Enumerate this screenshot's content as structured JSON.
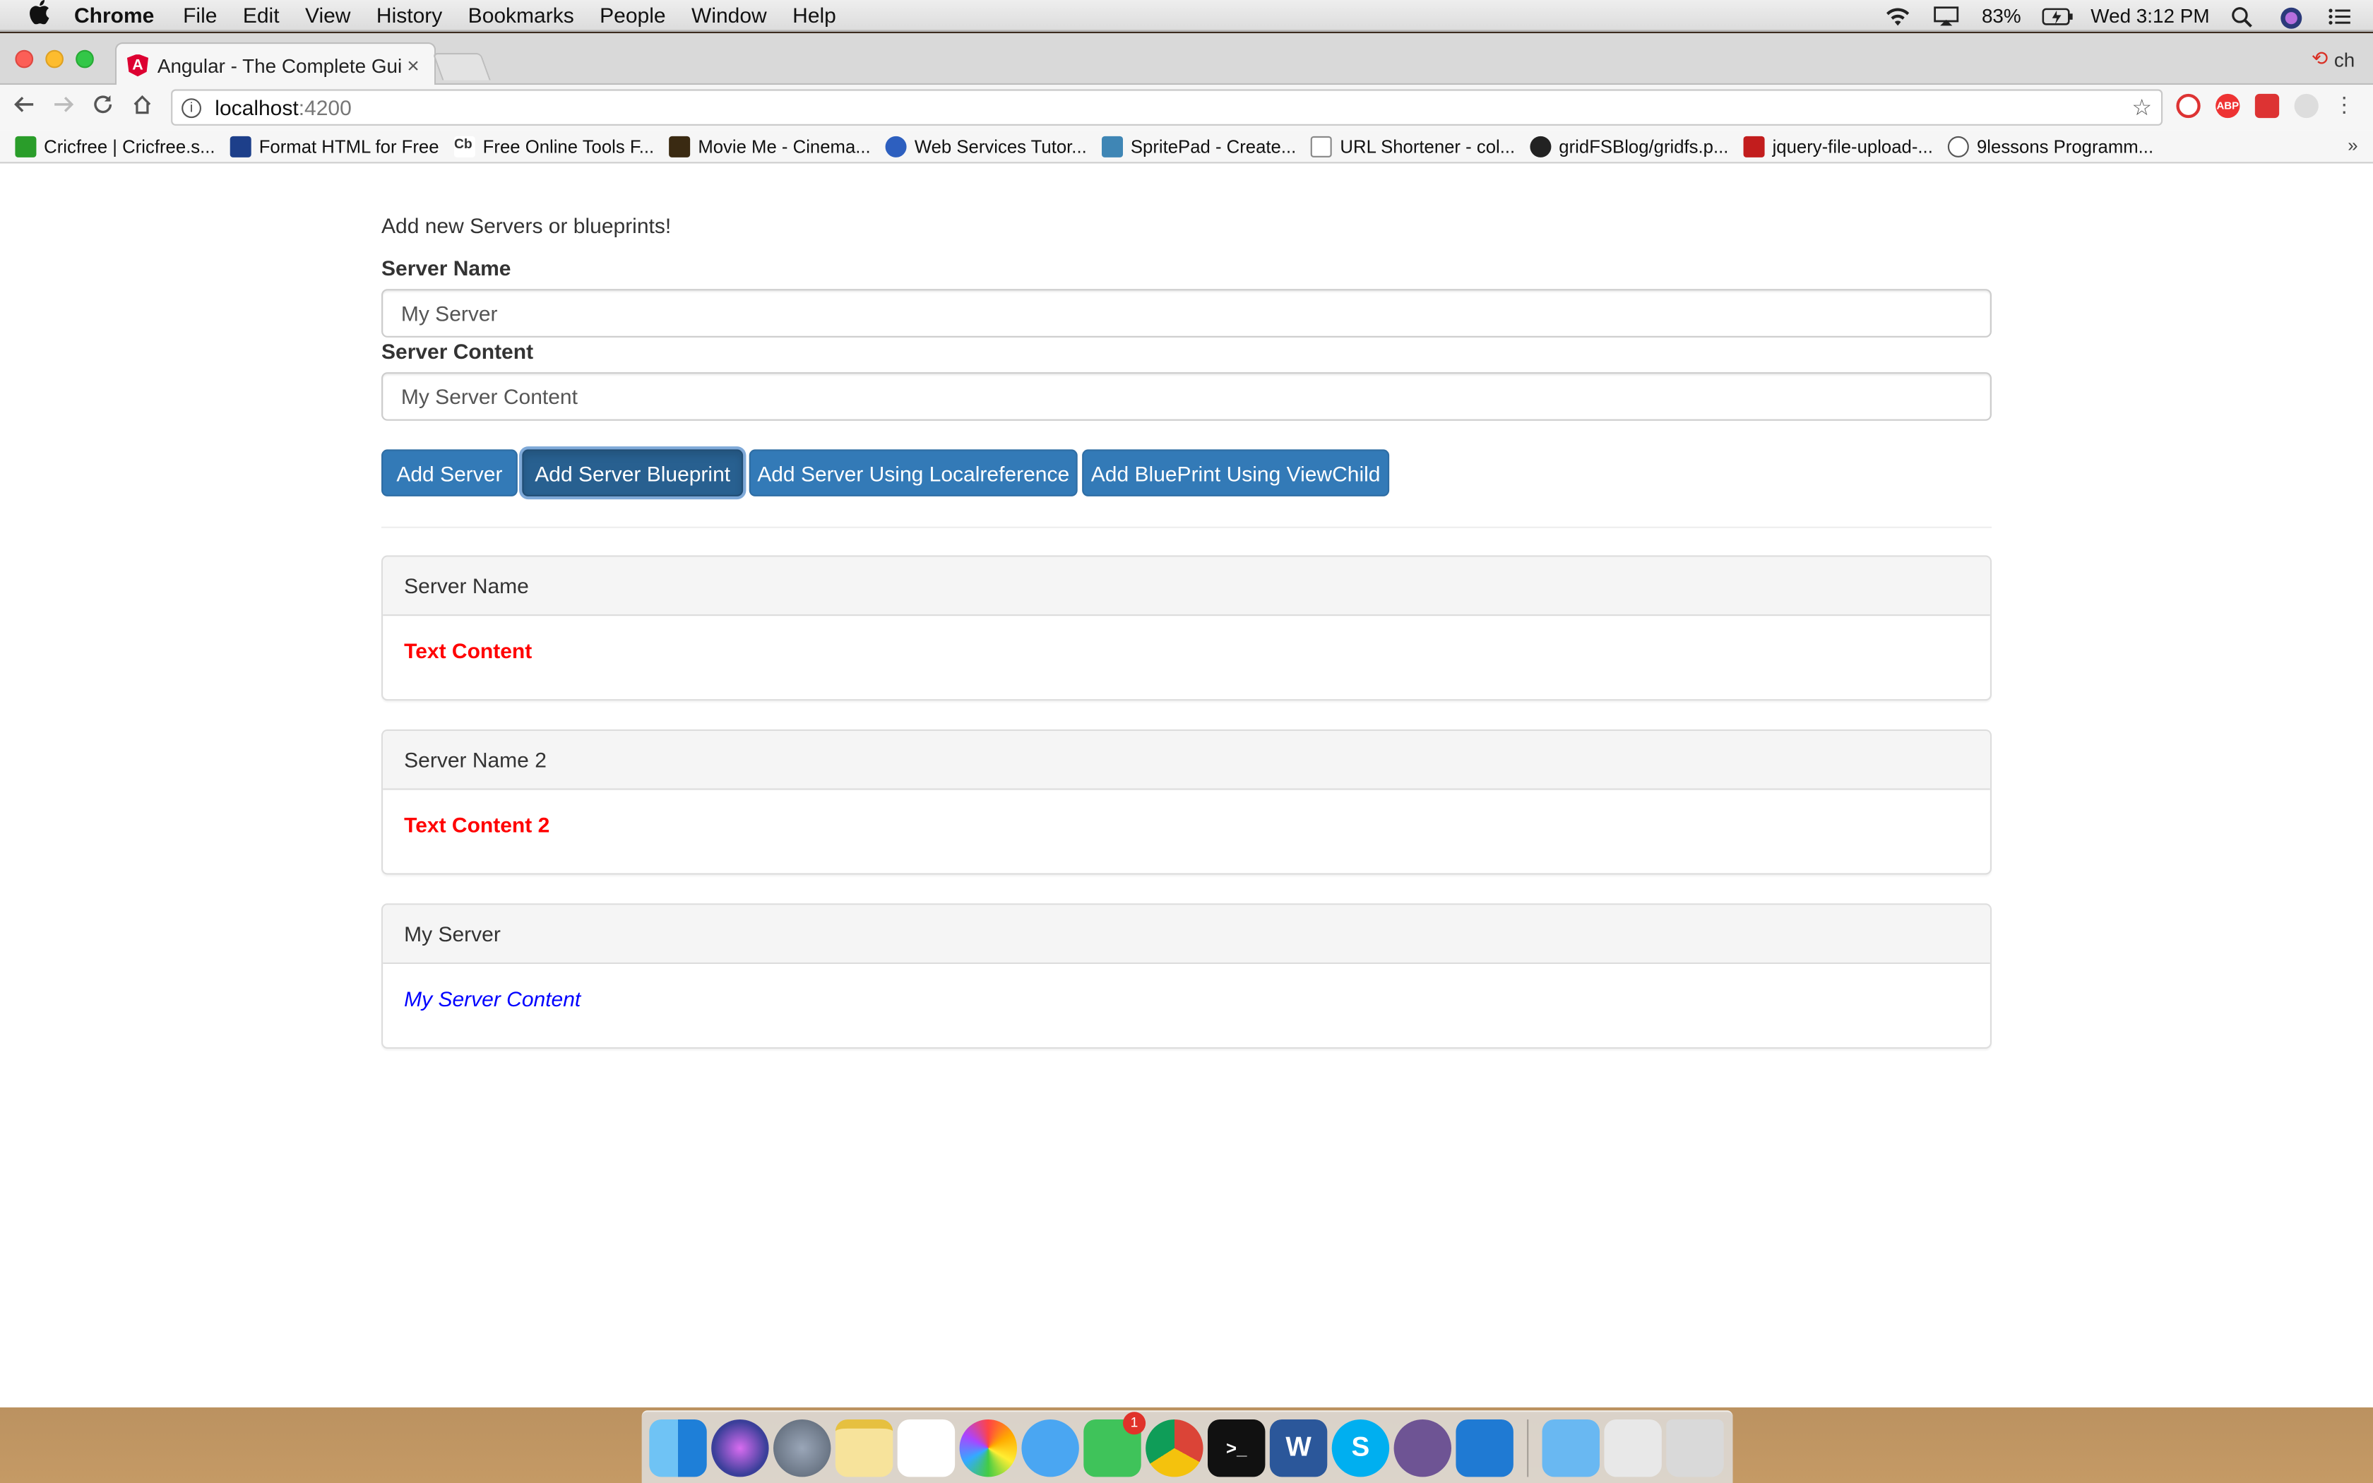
{
  "menubar": {
    "app": "Chrome",
    "items": [
      "File",
      "Edit",
      "View",
      "History",
      "Bookmarks",
      "People",
      "Window",
      "Help"
    ],
    "battery": "83%",
    "clock": "Wed 3:12 PM"
  },
  "browser": {
    "tab_title": "Angular - The Complete Guide",
    "tab_close": "×",
    "profile": "ch",
    "url_host": "localhost",
    "url_port": ":4200",
    "bookmarks": [
      "Cricfree | Cricfree.s...",
      "Format HTML for Free",
      "Free Online Tools F...",
      "Movie Me - Cinema...",
      "Web Services Tutor...",
      "SpritePad - Create...",
      "URL Shortener - col...",
      "gridFSBlog/gridfs.p...",
      "jquery-file-upload-...",
      "9lessons Programm..."
    ],
    "bookmarks_more": "»"
  },
  "app": {
    "intro": "Add new Servers or blueprints!",
    "server_name_label": "Server Name",
    "server_name_value": "My Server",
    "server_content_label": "Server Content",
    "server_content_value": "My Server Content",
    "buttons": {
      "add_server": "Add Server",
      "add_blueprint": "Add Server Blueprint",
      "add_local_ref": "Add Server Using Localreference",
      "add_viewchild": "Add BluePrint Using ViewChild"
    },
    "panels": [
      {
        "heading": "Server Name",
        "content": "Text Content",
        "style": "server"
      },
      {
        "heading": "Server Name 2",
        "content": "Text Content 2",
        "style": "server"
      },
      {
        "heading": "My Server",
        "content": "My Server Content",
        "style": "blueprint"
      }
    ]
  },
  "dock": {
    "facetime_badge": "1"
  },
  "colors": {
    "primary": "#337ab7",
    "server_text": "#ff0000",
    "blueprint_text": "#0000ff"
  }
}
